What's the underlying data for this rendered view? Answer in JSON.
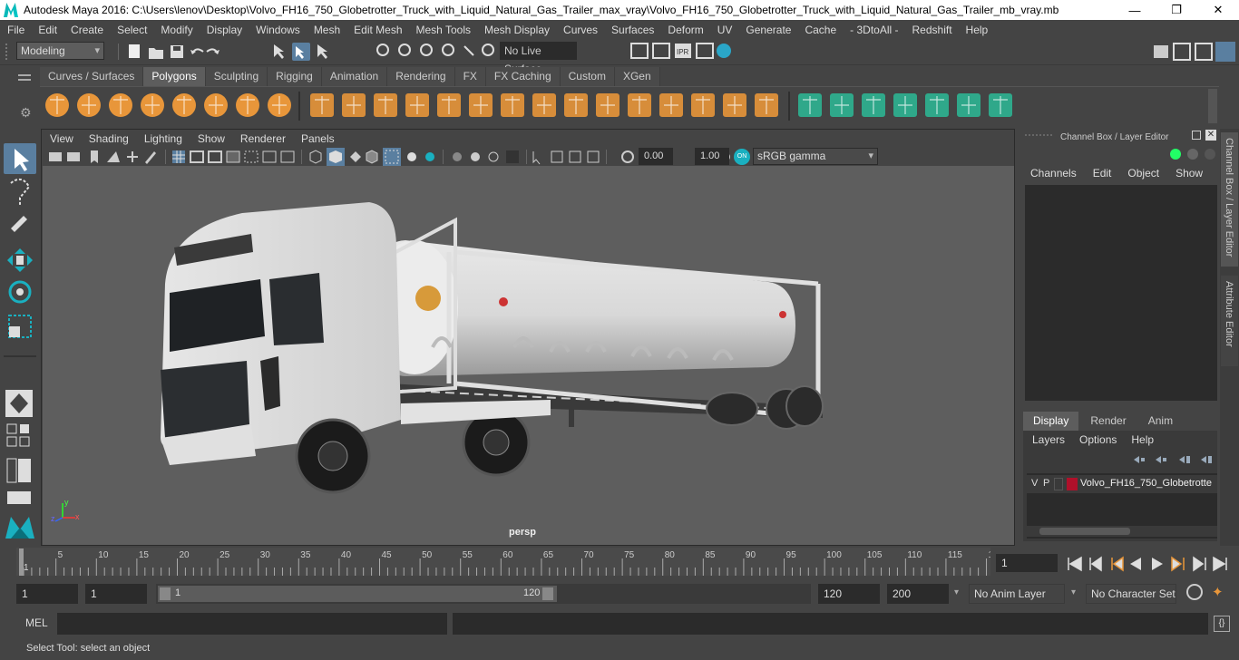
{
  "window": {
    "title": "Autodesk Maya 2016: C:\\Users\\lenov\\Desktop\\Volvo_FH16_750_Globetrotter_Truck_with_Liquid_Natural_Gas_Trailer_max_vray\\Volvo_FH16_750_Globetrotter_Truck_with_Liquid_Natural_Gas_Trailer_mb_vray.mb",
    "minimize": "—",
    "maximize": "❐",
    "close": "✕"
  },
  "menubar": [
    "File",
    "Edit",
    "Create",
    "Select",
    "Modify",
    "Display",
    "Windows",
    "Mesh",
    "Edit Mesh",
    "Mesh Tools",
    "Mesh Display",
    "Curves",
    "Surfaces",
    "Deform",
    "UV",
    "Generate",
    "Cache",
    "- 3DtoAll -",
    "Redshift",
    "Help"
  ],
  "statusline": {
    "mode": "Modeling",
    "live_surface": "No Live Surface"
  },
  "shelf_tabs": [
    {
      "label": "Curves / Surfaces",
      "active": false
    },
    {
      "label": "Polygons",
      "active": true
    },
    {
      "label": "Sculpting",
      "active": false
    },
    {
      "label": "Rigging",
      "active": false
    },
    {
      "label": "Animation",
      "active": false
    },
    {
      "label": "Rendering",
      "active": false
    },
    {
      "label": "FX",
      "active": false
    },
    {
      "label": "FX Caching",
      "active": false
    },
    {
      "label": "Custom",
      "active": false
    },
    {
      "label": "XGen",
      "active": false
    }
  ],
  "viewport": {
    "menus": [
      "View",
      "Shading",
      "Lighting",
      "Show",
      "Renderer",
      "Panels"
    ],
    "exposure": "0.00",
    "gamma": "1.00",
    "color_space": "sRGB gamma",
    "camera_label": "persp",
    "axis_y": "y",
    "axis_x": "x",
    "axis_z": "z"
  },
  "channel_box": {
    "title": "Channel Box / Layer Editor",
    "menus": [
      "Channels",
      "Edit",
      "Object",
      "Show"
    ]
  },
  "layer_editor": {
    "tabs": [
      "Display",
      "Render",
      "Anim"
    ],
    "active_tab": "Display",
    "menus": [
      "Layers",
      "Options",
      "Help"
    ],
    "layer": {
      "v": "V",
      "p": "P",
      "name": "Volvo_FH16_750_Globetrotte",
      "color": "#b0102a"
    }
  },
  "side_tabs": [
    "Channel Box / Layer Editor",
    "Attribute Editor"
  ],
  "timeline": {
    "ticks": [
      "5",
      "10",
      "15",
      "20",
      "25",
      "30",
      "35",
      "40",
      "45",
      "50",
      "55",
      "60",
      "65",
      "70",
      "75",
      "80",
      "85",
      "90",
      "95",
      "100",
      "105",
      "110",
      "115",
      "12"
    ],
    "first_tick": "1",
    "current_frame": "1"
  },
  "range": {
    "start": "1",
    "playback_start": "1",
    "slider_start": "1",
    "slider_end": "120",
    "playback_end": "120",
    "end": "200",
    "anim_layer": "No Anim Layer",
    "character_set": "No Character Set"
  },
  "cmdline": {
    "label": "MEL"
  },
  "helpline": {
    "text": "Select Tool: select an object"
  },
  "colors": {
    "accent": "#1ab0c0",
    "shelf_orange": "#e8963a",
    "shelf_green": "#2fa88a",
    "layer_red": "#b0102a"
  }
}
